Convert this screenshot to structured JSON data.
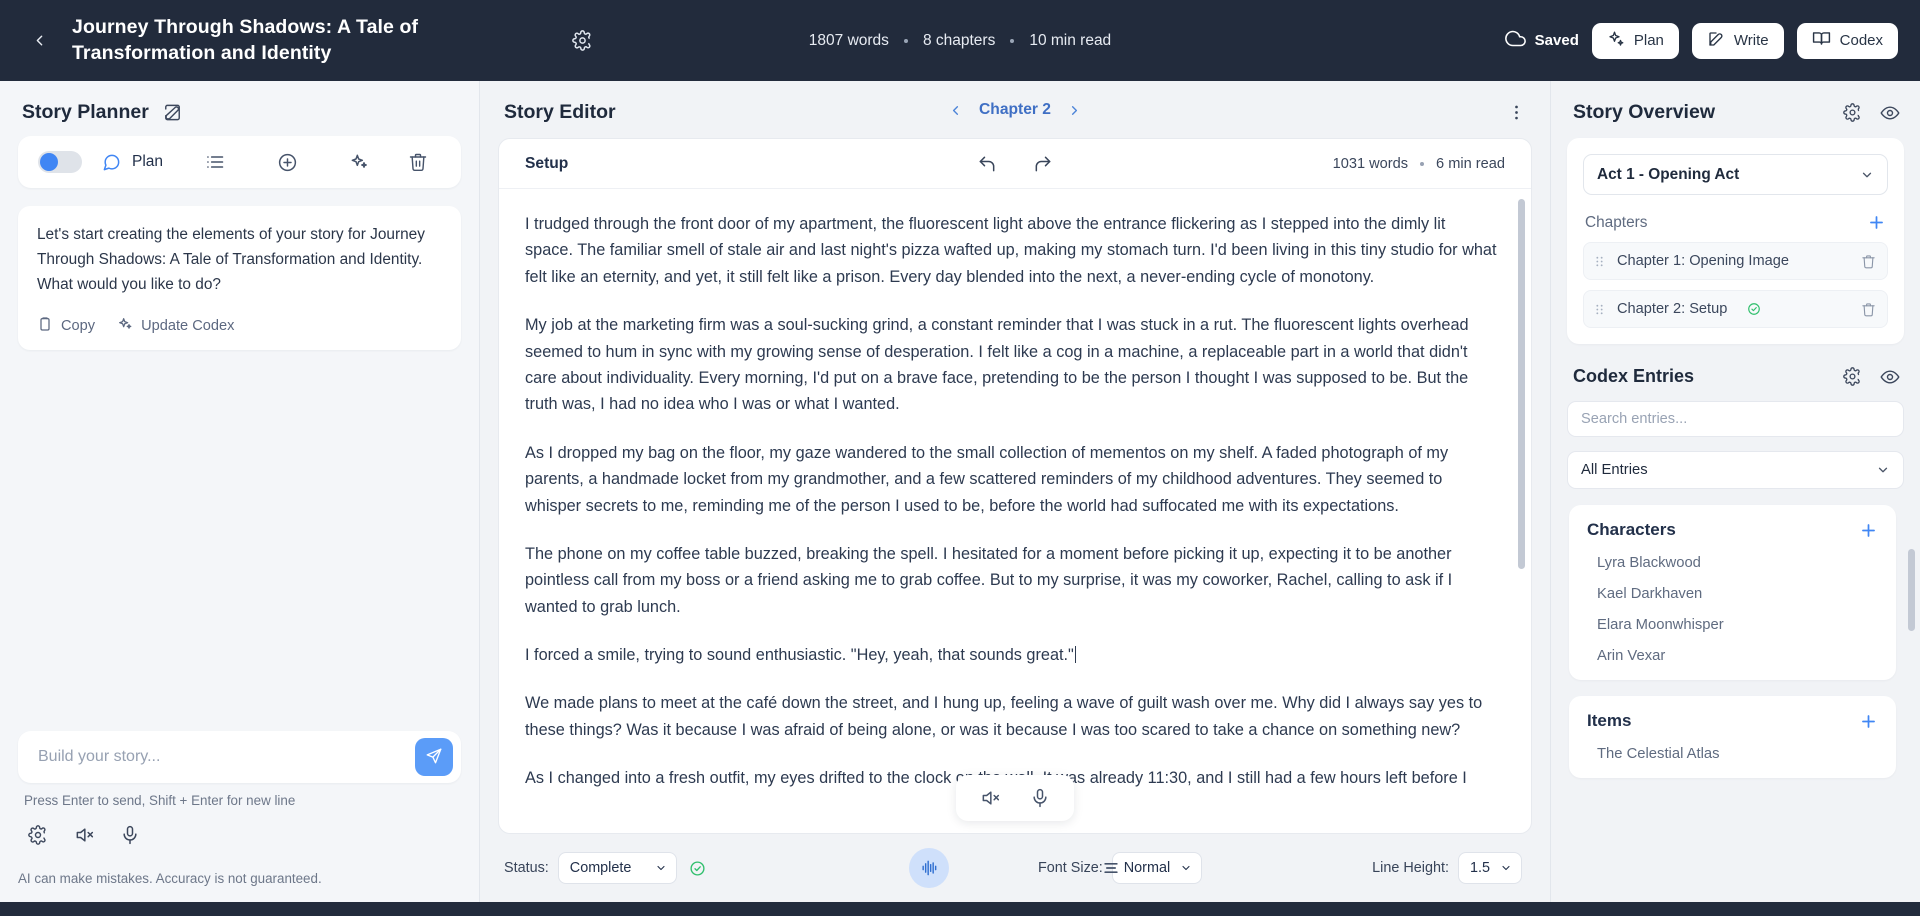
{
  "topbar": {
    "back_icon": "chevron-left-icon",
    "title": "Journey Through Shadows: A Tale of Transformation and Identity",
    "settings_icon": "gear-icon",
    "meta": [
      {
        "text": "1807 words"
      },
      {
        "text": "8 chapters"
      },
      {
        "text": "10 min read"
      }
    ],
    "saved_label": "Saved",
    "saved_icon": "cloud-icon",
    "buttons": [
      {
        "label": "Plan",
        "icon": "sparkles-icon"
      },
      {
        "label": "Write",
        "icon": "pencil-square-icon"
      },
      {
        "label": "Codex",
        "icon": "book-open-icon"
      }
    ]
  },
  "left": {
    "title": "Story Planner",
    "edit_icon": "edit-square-icon",
    "toolbar": {
      "toggle_on": true,
      "chat_icon": "chat-bubble-icon",
      "mode_label": "Plan",
      "list_icon": "list-icon",
      "add_icon": "plus-circle-icon",
      "sparkle_icon": "sparkles-icon",
      "trash_icon": "trash-icon"
    },
    "message": {
      "text": "Let's start creating the elements of your story for Journey Through Shadows: A Tale of Transformation and Identity. What would you like to do?",
      "actions": [
        {
          "label": "Copy",
          "icon": "clipboard-icon"
        },
        {
          "label": "Update Codex",
          "icon": "sparkles-icon"
        }
      ]
    },
    "composer": {
      "placeholder": "Build your story...",
      "value": "",
      "send_icon": "send-icon",
      "hint": "Press Enter to send, Shift + Enter for new line",
      "icons": [
        {
          "name": "gear-icon"
        },
        {
          "name": "speaker-mute-icon"
        },
        {
          "name": "microphone-icon"
        }
      ]
    },
    "disclaimer": "AI can make mistakes. Accuracy is not guaranteed."
  },
  "center": {
    "title": "Story Editor",
    "chapter_prev_icon": "chevron-left-icon",
    "chapter_label": "Chapter 2",
    "chapter_next_icon": "chevron-right-icon",
    "menu_icon": "kebab-menu-icon",
    "editor": {
      "scene_label": "Setup",
      "undo_icon": "undo-icon",
      "redo_icon": "redo-icon",
      "word_count": "1031 words",
      "read_time": "6 min read",
      "paragraphs": [
        "I trudged through the front door of my apartment, the fluorescent light above the entrance flickering as I stepped into the dimly lit space. The familiar smell of stale air and last night's pizza wafted up, making my stomach turn. I'd been living in this tiny studio for what felt like an eternity, and yet, it still felt like a prison. Every day blended into the next, a never-ending cycle of monotony.",
        "My job at the marketing firm was a soul-sucking grind, a constant reminder that I was stuck in a rut. The fluorescent lights overhead seemed to hum in sync with my growing sense of desperation. I felt like a cog in a machine, a replaceable part in a world that didn't care about individuality. Every morning, I'd put on a brave face, pretending to be the person I thought I was supposed to be. But the truth was, I had no idea who I was or what I wanted.",
        "As I dropped my bag on the floor, my gaze wandered to the small collection of mementos on my shelf. A faded photograph of my parents, a handmade locket from my grandmother, and a few scattered reminders of my childhood adventures. They seemed to whisper secrets to me, reminding me of the person I used to be, before the world had suffocated me with its expectations.",
        "The phone on my coffee table buzzed, breaking the spell. I hesitated for a moment before picking it up, expecting it to be another pointless call from my boss or a friend asking me to grab coffee. But to my surprise, it was my coworker, Rachel, calling to ask if I wanted to grab lunch.",
        "I forced a smile, trying to sound enthusiastic. \"Hey, yeah, that sounds great.\"",
        "We made plans to meet at the café down the street, and I hung up, feeling a wave of guilt wash over me. Why did I always say yes to these things? Was it because I was afraid of being alone, or was it because I was too scared to take a chance on something new?",
        "As I changed into a fresh outfit, my eyes drifted to the clock on the wall. It was already 11:30, and I still had a few hours left before I"
      ],
      "audio_icons": [
        {
          "name": "speaker-mute-icon"
        },
        {
          "name": "microphone-icon"
        }
      ]
    },
    "bottom_toolbar": {
      "status_label": "Status:",
      "status_value": "Complete",
      "status_check_icon": "check-circle-icon",
      "waveform_icon": "waveform-icon",
      "align_icon": "text-align-icon",
      "font_size_label": "Font Size:",
      "font_size_value": "Normal",
      "line_height_label": "Line Height:",
      "line_height_value": "1.5"
    }
  },
  "right": {
    "overview": {
      "title": "Story Overview",
      "settings_icon": "gear-icon",
      "eye_icon": "eye-icon",
      "act_value": "Act 1 - Opening Act",
      "chapters_label": "Chapters",
      "add_chapter_icon": "plus-icon",
      "chapters": [
        {
          "name": "Chapter 1: Opening Image",
          "complete": false
        },
        {
          "name": "Chapter 2: Setup",
          "complete": true
        }
      ]
    },
    "codex": {
      "title": "Codex Entries",
      "settings_icon": "gear-icon",
      "eye_icon": "eye-icon",
      "search_placeholder": "Search entries...",
      "search_value": "",
      "filter_value": "All Entries",
      "groups": [
        {
          "title": "Characters",
          "add_icon": "plus-icon",
          "entries": [
            "Lyra Blackwood",
            "Kael Darkhaven",
            "Elara Moonwhisper",
            "Arin Vexar"
          ]
        },
        {
          "title": "Items",
          "add_icon": "plus-icon",
          "entries": [
            "The Celestial Atlas"
          ]
        }
      ]
    }
  },
  "colors": {
    "topbar_bg": "#222b3c",
    "accent_blue": "#4086f4",
    "success_green": "#2fbf6c",
    "page_bg": "#f1f3f6"
  }
}
